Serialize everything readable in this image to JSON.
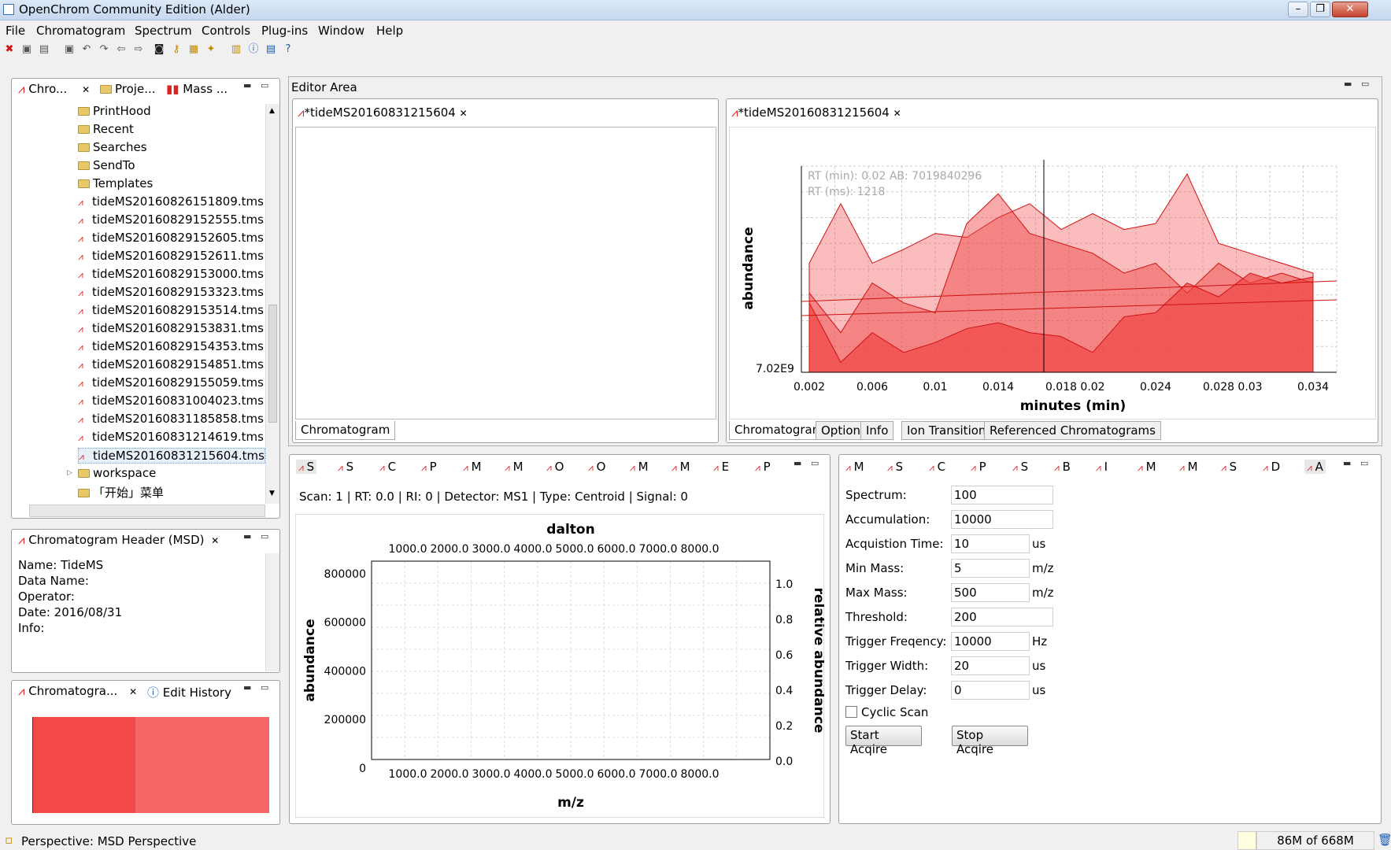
{
  "window": {
    "title": "OpenChrom Community Edition (Alder)"
  },
  "menu": [
    "File",
    "Chromatogram",
    "Spectrum",
    "Controls",
    "Plug-ins",
    "Window",
    "Help"
  ],
  "left_panel": {
    "tabs": [
      "Chro...",
      "Proje...",
      "Mass ..."
    ],
    "tree_items": [
      {
        "label": "PrintHood",
        "type": "folder"
      },
      {
        "label": "Recent",
        "type": "folder"
      },
      {
        "label": "Searches",
        "type": "folder"
      },
      {
        "label": "SendTo",
        "type": "folder"
      },
      {
        "label": "Templates",
        "type": "folder"
      },
      {
        "label": "tideMS20160826151809.tms",
        "type": "file"
      },
      {
        "label": "tideMS20160829152555.tms",
        "type": "file"
      },
      {
        "label": "tideMS20160829152605.tms",
        "type": "file"
      },
      {
        "label": "tideMS20160829152611.tms",
        "type": "file"
      },
      {
        "label": "tideMS20160829153000.tms",
        "type": "file"
      },
      {
        "label": "tideMS20160829153323.tms",
        "type": "file"
      },
      {
        "label": "tideMS20160829153514.tms",
        "type": "file"
      },
      {
        "label": "tideMS20160829153831.tms",
        "type": "file"
      },
      {
        "label": "tideMS20160829154353.tms",
        "type": "file"
      },
      {
        "label": "tideMS20160829154851.tms",
        "type": "file"
      },
      {
        "label": "tideMS20160829155059.tms",
        "type": "file"
      },
      {
        "label": "tideMS20160831004023.tms",
        "type": "file"
      },
      {
        "label": "tideMS20160831185858.tms",
        "type": "file"
      },
      {
        "label": "tideMS20160831214619.tms",
        "type": "file"
      },
      {
        "label": "tideMS20160831215604.tms",
        "type": "file"
      },
      {
        "label": "workspace",
        "type": "folder"
      },
      {
        "label": "「开始」菜单",
        "type": "folder"
      }
    ]
  },
  "header_panel": {
    "title": "Chromatogram Header (MSD)",
    "lines": [
      "Name: TideMS",
      "Data Name:",
      "Operator:",
      "Date: 2016/08/31",
      "Info:"
    ]
  },
  "overview_panel": {
    "tab1": "Chromatogra...",
    "tab2": "Edit History"
  },
  "editor": {
    "title": "Editor Area",
    "left_tab": "*tideMS20160831215604",
    "right_tab": "*tideMS20160831215604",
    "left_bottom_tab": "Chromatogram",
    "right_bottom_tabs": [
      "Chromatogram",
      "Options",
      "Info",
      "Ion Transitions",
      "Referenced Chromatograms"
    ]
  },
  "chrom_chart": {
    "info_rt_min": "RT (min): 0.02 AB: 7019840296",
    "info_rt_ms": "RT (ms): 1218",
    "ylabel": "abundance",
    "xlabel": "minutes (min)",
    "ytick": "7.02E9",
    "xticks": [
      "0.002",
      "0.006",
      "0.01",
      "0.014",
      "0.018",
      "0.02",
      "0.024",
      "0.028",
      "0.03",
      "0.034"
    ]
  },
  "chart_data": {
    "type": "area",
    "xlabel": "minutes (min)",
    "ylabel": "abundance",
    "x": [
      0.002,
      0.004,
      0.006,
      0.008,
      0.01,
      0.012,
      0.014,
      0.016,
      0.018,
      0.02,
      0.022,
      0.024,
      0.026,
      0.028,
      0.03,
      0.032,
      0.034
    ],
    "series": [
      {
        "values": [
          0.55,
          0.85,
          0.55,
          0.62,
          0.7,
          0.68,
          0.78,
          0.85,
          0.72,
          0.8,
          0.72,
          0.75,
          1.0,
          0.65,
          0.6,
          0.55,
          0.5
        ]
      },
      {
        "values": [
          0.4,
          0.2,
          0.45,
          0.35,
          0.3,
          0.75,
          0.9,
          0.7,
          0.65,
          0.6,
          0.5,
          0.55,
          0.4,
          0.55,
          0.45,
          0.5,
          0.45
        ]
      },
      {
        "values": [
          0.35,
          0.05,
          0.2,
          0.1,
          0.15,
          0.22,
          0.25,
          0.2,
          0.18,
          0.1,
          0.28,
          0.3,
          0.45,
          0.38,
          0.5,
          0.45,
          0.48
        ]
      }
    ]
  },
  "scan_panel": {
    "tabs": [
      "S",
      "S",
      "C",
      "P",
      "M",
      "M",
      "O",
      "O",
      "M",
      "M",
      "E",
      "P"
    ],
    "info": "Scan: 1 | RT: 0.0 | RI: 0 | Detector: MS1 | Type: Centroid | Signal: 0",
    "top_label": "dalton",
    "xlabel": "m/z",
    "ylabel": "abundance",
    "y2label": "relative abundance",
    "xticks": [
      "1000.0",
      "2000.0",
      "3000.0",
      "4000.0",
      "5000.0",
      "6000.0",
      "7000.0",
      "8000.0"
    ],
    "yticks": [
      "800000",
      "600000",
      "400000",
      "200000",
      "0"
    ],
    "y2ticks": [
      "1.0",
      "0.8",
      "0.6",
      "0.4",
      "0.2",
      "0.0"
    ]
  },
  "acq_panel": {
    "tabs": [
      "M",
      "S",
      "C",
      "P",
      "S",
      "B",
      "I",
      "M",
      "M",
      "S",
      "D",
      "A"
    ],
    "fields": [
      {
        "label": "Spectrum:",
        "value": "100",
        "unit": ""
      },
      {
        "label": "Accumulation:",
        "value": "10000",
        "unit": ""
      },
      {
        "label": "Acquistion Time:",
        "value": "10",
        "unit": "us"
      },
      {
        "label": "Min Mass:",
        "value": "5",
        "unit": "m/z"
      },
      {
        "label": "Max Mass:",
        "value": "500",
        "unit": "m/z"
      },
      {
        "label": "Threshold:",
        "value": "200",
        "unit": ""
      },
      {
        "label": "Trigger Freqency:",
        "value": "10000",
        "unit": "Hz"
      },
      {
        "label": "Trigger Width:",
        "value": "20",
        "unit": "us"
      },
      {
        "label": "Trigger Delay:",
        "value": "0",
        "unit": "us"
      }
    ],
    "cyclic_label": "Cyclic Scan",
    "start_label": "Start Acqire",
    "stop_label": "Stop Acqire"
  },
  "status": {
    "perspective": "Perspective: MSD Perspective",
    "memory": "86M of 668M"
  },
  "colors": {
    "accent_red": "#e8272b",
    "area_fill": "#f04040",
    "titlebar": "#c6d8ef"
  }
}
